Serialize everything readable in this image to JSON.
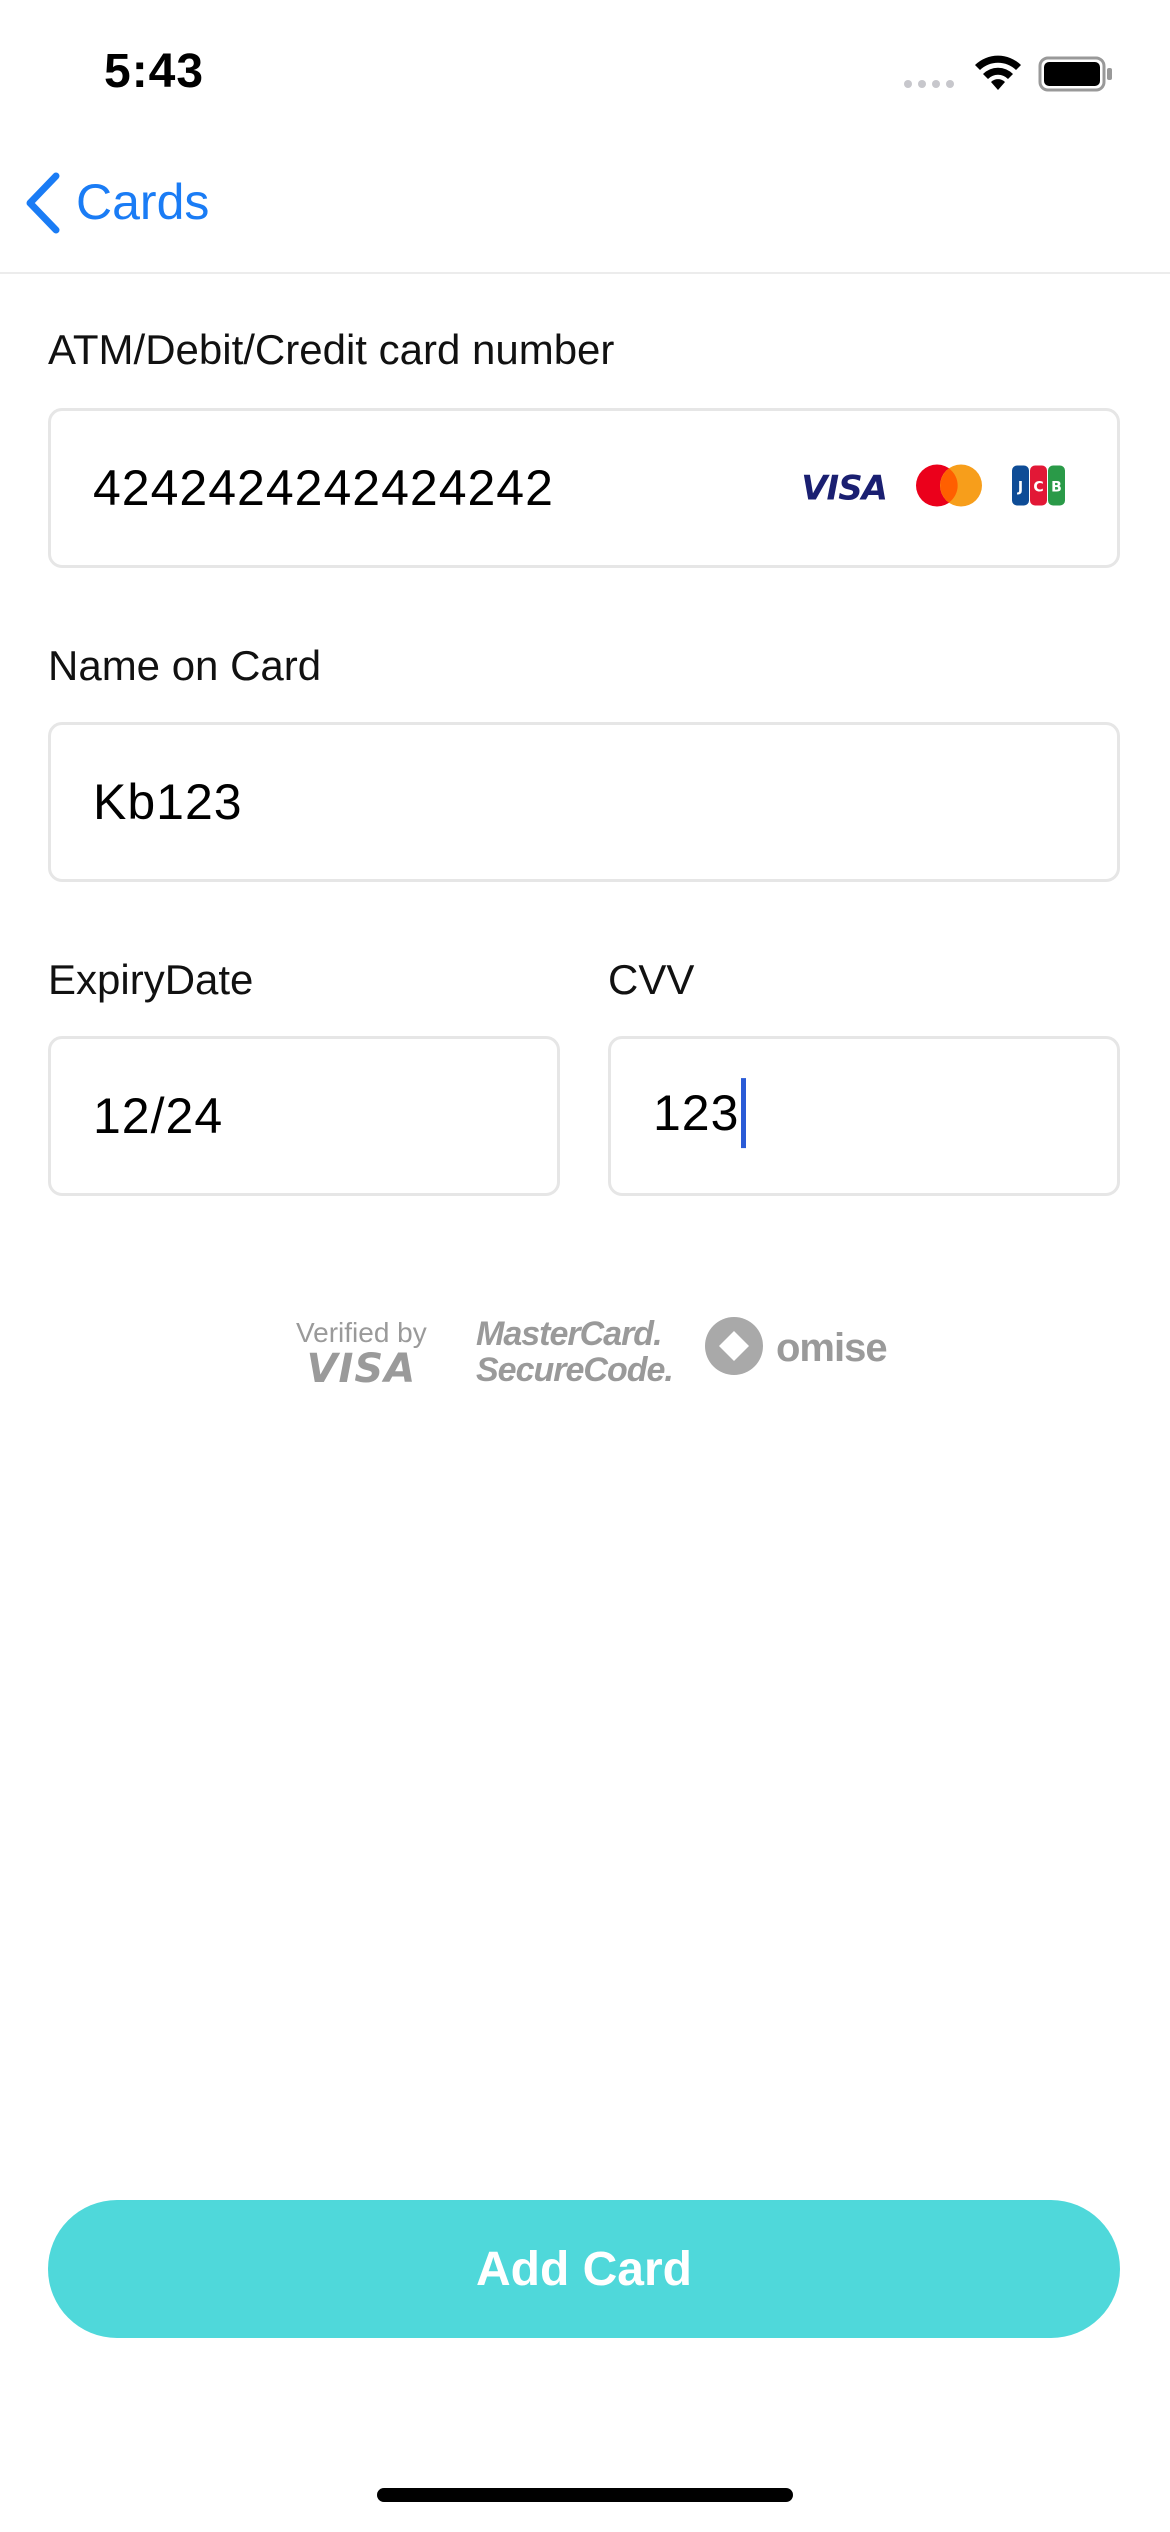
{
  "status_bar": {
    "time": "5:43"
  },
  "nav": {
    "back_label": "Cards",
    "accent_color": "#1a7cf5"
  },
  "form": {
    "card_number": {
      "label": "ATM/Debit/Credit card number",
      "value": "4242424242424242",
      "brands": [
        "VISA",
        "mastercard-icon",
        "jcb-icon"
      ]
    },
    "name": {
      "label": "Name on Card",
      "value": "Kb123"
    },
    "expiry": {
      "label": "ExpiryDate",
      "value": "12/24"
    },
    "cvv": {
      "label": "CVV",
      "value": "123"
    }
  },
  "badges": {
    "visa_small": "Verified by",
    "visa_big": "VISA",
    "mastercard_line1": "MasterCard.",
    "mastercard_line2": "SecureCode.",
    "omise": "omise"
  },
  "actions": {
    "add_card": "Add Card",
    "add_card_color": "#4fd8da"
  }
}
